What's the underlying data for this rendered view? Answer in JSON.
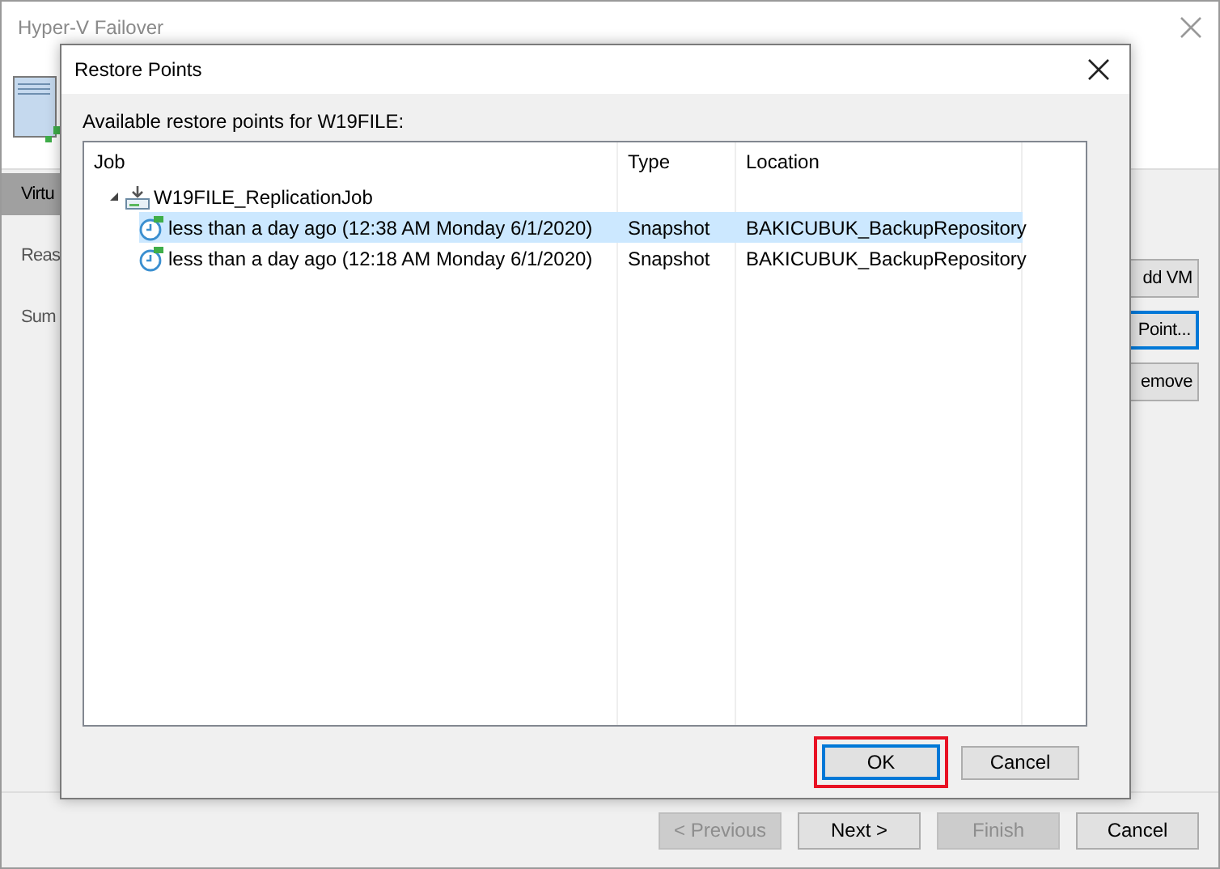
{
  "window": {
    "title": "Hyper-V Failover"
  },
  "sidebar": {
    "items": [
      {
        "label": "Virtu",
        "selected": true
      },
      {
        "label": "Reas",
        "selected": false
      },
      {
        "label": "Sum",
        "selected": false
      }
    ]
  },
  "side_buttons": [
    {
      "label": "dd VM",
      "focused": false
    },
    {
      "label": "Point...",
      "focused": true
    },
    {
      "label": "emove",
      "focused": false
    }
  ],
  "wizard_buttons": [
    {
      "label": "< Previous",
      "disabled": true
    },
    {
      "label": "Next >",
      "disabled": false
    },
    {
      "label": "Finish",
      "disabled": true
    },
    {
      "label": "Cancel",
      "disabled": false
    }
  ],
  "dialog": {
    "title": "Restore Points",
    "prompt": "Available restore points for W19FILE:",
    "table": {
      "columns": [
        "Job",
        "Type",
        "Location"
      ],
      "tree": [
        {
          "kind": "job",
          "label": "W19FILE_ReplicationJob",
          "expanded": true,
          "selected": false,
          "children": [
            {
              "kind": "point",
              "label": "less than a day ago (12:38 AM Monday 6/1/2020)",
              "type": "Snapshot",
              "location": "BAKICUBUK_BackupRepository",
              "selected": true
            },
            {
              "kind": "point",
              "label": "less than a day ago (12:18 AM Monday 6/1/2020)",
              "type": "Snapshot",
              "location": "BAKICUBUK_BackupRepository",
              "selected": false
            }
          ]
        }
      ]
    },
    "buttons": [
      {
        "label": "OK",
        "default": true,
        "highlighted": true
      },
      {
        "label": "Cancel",
        "default": false,
        "highlighted": false
      }
    ]
  }
}
